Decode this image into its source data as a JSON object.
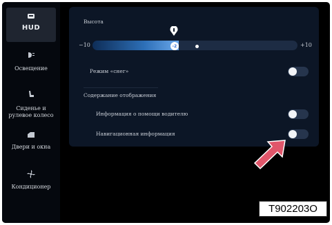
{
  "sidebar": {
    "items": [
      {
        "label": "HUD",
        "icon": "hud-icon",
        "active": true
      },
      {
        "label": "Освещение",
        "icon": "light-icon"
      },
      {
        "label": "Сиденье и рулевое колесо",
        "icon": "seat-icon"
      },
      {
        "label": "Двери и окна",
        "icon": "door-icon"
      },
      {
        "label": "Кондиционер",
        "icon": "fan-icon"
      }
    ],
    "seat_label_line1": "Сиденье и",
    "seat_label_line2": "рулевое колесо"
  },
  "panel": {
    "height_title": "Высота",
    "slider": {
      "min_label": "−10",
      "max_label": "+10",
      "min": -10,
      "max": 10,
      "value": -2,
      "value_label": "-2"
    },
    "snow_mode_label": "Режим «снег»",
    "snow_mode_on": false,
    "display_section_title": "Содержание отображения",
    "driver_assist_label": "Информация о помощи водителю",
    "driver_assist_on": false,
    "navigation_label": "Навигационная информация",
    "navigation_on": false
  },
  "figure_code": "T902203O",
  "colors": {
    "accent": "#2d6fb7",
    "panel_bg": "#0c1626",
    "arrow": "#e0566a"
  }
}
